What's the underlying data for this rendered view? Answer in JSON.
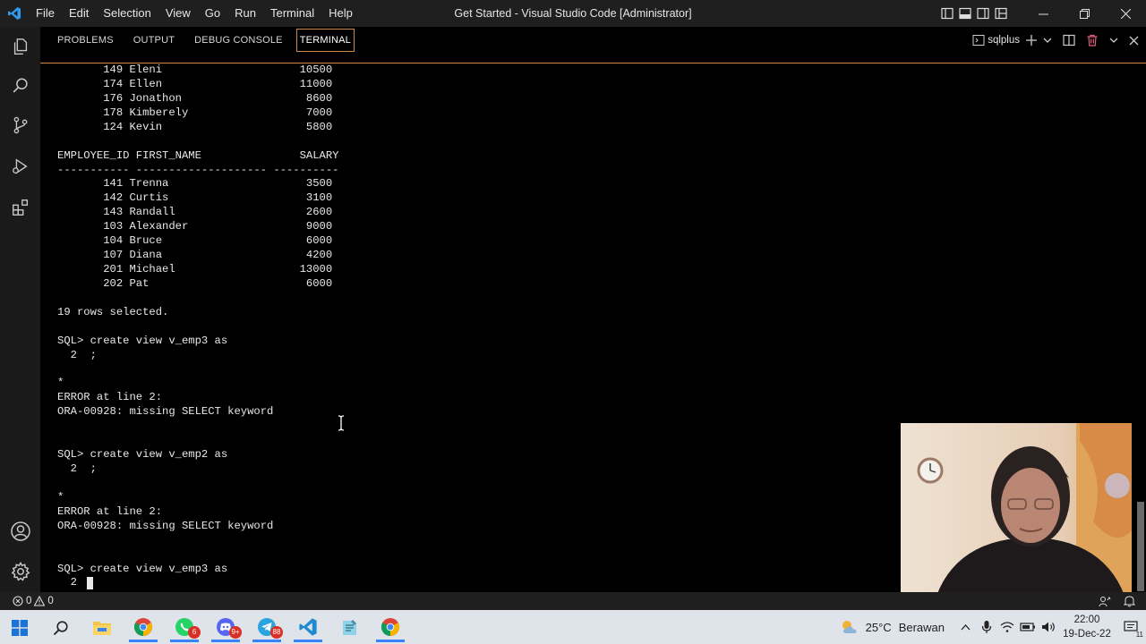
{
  "app": {
    "window_title": "Get Started - Visual Studio Code [Administrator]",
    "menu": [
      "File",
      "Edit",
      "Selection",
      "View",
      "Go",
      "Run",
      "Terminal",
      "Help"
    ]
  },
  "panel": {
    "tabs": [
      "PROBLEMS",
      "OUTPUT",
      "DEBUG CONSOLE",
      "TERMINAL"
    ],
    "active_tab": "TERMINAL",
    "terminal_name": "sqlplus"
  },
  "terminal": {
    "lines": [
      "       149 Eleni                     10500",
      "       174 Ellen                     11000",
      "       176 Jonathon                   8600",
      "       178 Kimberely                  7000",
      "       124 Kevin                      5800",
      "",
      "EMPLOYEE_ID FIRST_NAME               SALARY",
      "----------- -------------------- ----------",
      "       141 Trenna                     3500",
      "       142 Curtis                     3100",
      "       143 Randall                    2600",
      "       103 Alexander                  9000",
      "       104 Bruce                      6000",
      "       107 Diana                      4200",
      "       201 Michael                   13000",
      "       202 Pat                        6000",
      "",
      "19 rows selected.",
      "",
      "SQL> create view v_emp3 as",
      "  2  ;",
      "",
      "*",
      "ERROR at line 2:",
      "ORA-00928: missing SELECT keyword",
      "",
      "",
      "SQL> create view v_emp2 as",
      "  2  ;",
      "",
      "*",
      "ERROR at line 2:",
      "ORA-00928: missing SELECT keyword",
      "",
      "",
      "SQL> create view v_emp3 as",
      "  2  "
    ]
  },
  "status": {
    "errors": "0",
    "warnings": "0"
  },
  "taskbar": {
    "weather_temp": "25°C",
    "weather_condition": "Berawan",
    "time": "22:00",
    "date": "19-Dec-22",
    "badges": {
      "chrome_profile": "",
      "whatsapp": "6",
      "discord": "9+",
      "telegram": "88"
    },
    "notification_count": "11"
  },
  "colors": {
    "accent": "#c98a4a",
    "titlebar": "#1f1f1f",
    "terminal_bg": "#000000",
    "taskbar": "#dfe3ea"
  }
}
